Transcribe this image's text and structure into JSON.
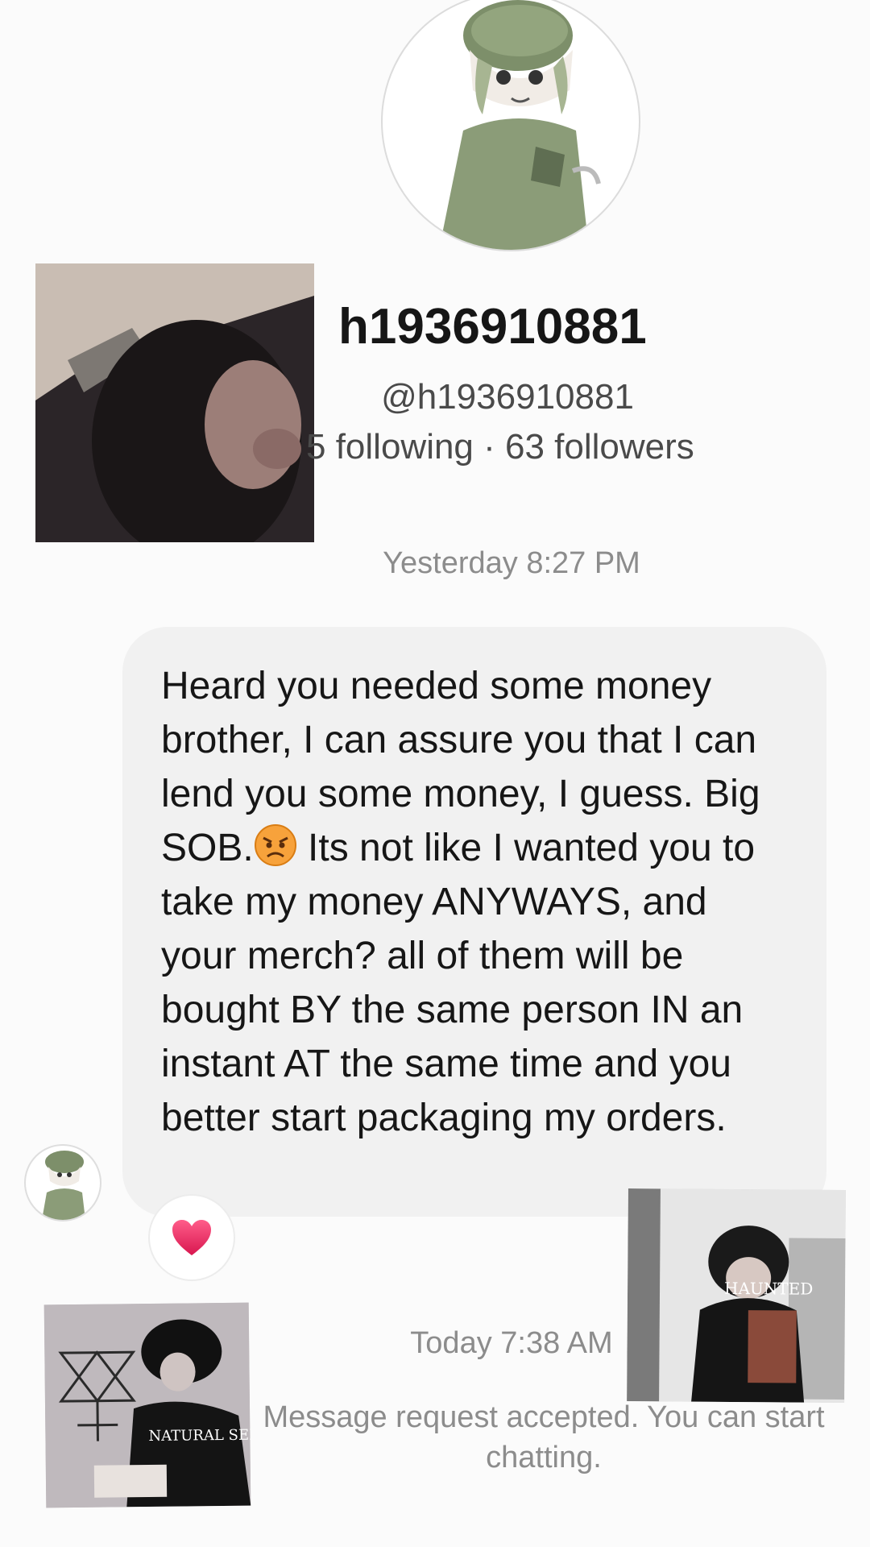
{
  "profile": {
    "username": "h1936910881",
    "handle": "@h1936910881",
    "follow_stats": "5 following · 63 followers",
    "avatar_icon": "anime-soldier-avatar-icon"
  },
  "conversation": {
    "timestamp_1": "Yesterday 8:27 PM",
    "message": {
      "text_before_emoji": "Heard you needed some money brother, I can assure you that I can lend you some money, I guess. Big SOB.",
      "emoji": "angry-face-emoji",
      "text_after_emoji": " Its not like I wanted you to take my money ANYWAYS, and your merch? all of them will be bought BY the same person IN an instant AT the same time and you better start packaging my orders."
    },
    "reaction": "heart-icon",
    "timestamp_2": "Today 7:38 AM",
    "system_message": "Message request accepted. You can start chatting."
  },
  "overlays": {
    "photo_bottom_right_text": "HAUNTED",
    "photo_bottom_left_text": "NATURAL SELECTION"
  },
  "colors": {
    "background": "#fbfbfb",
    "bubble": "#f1f1f1",
    "text_primary": "#161616",
    "text_secondary": "#8c8c8c",
    "heart": "#e8265e"
  }
}
